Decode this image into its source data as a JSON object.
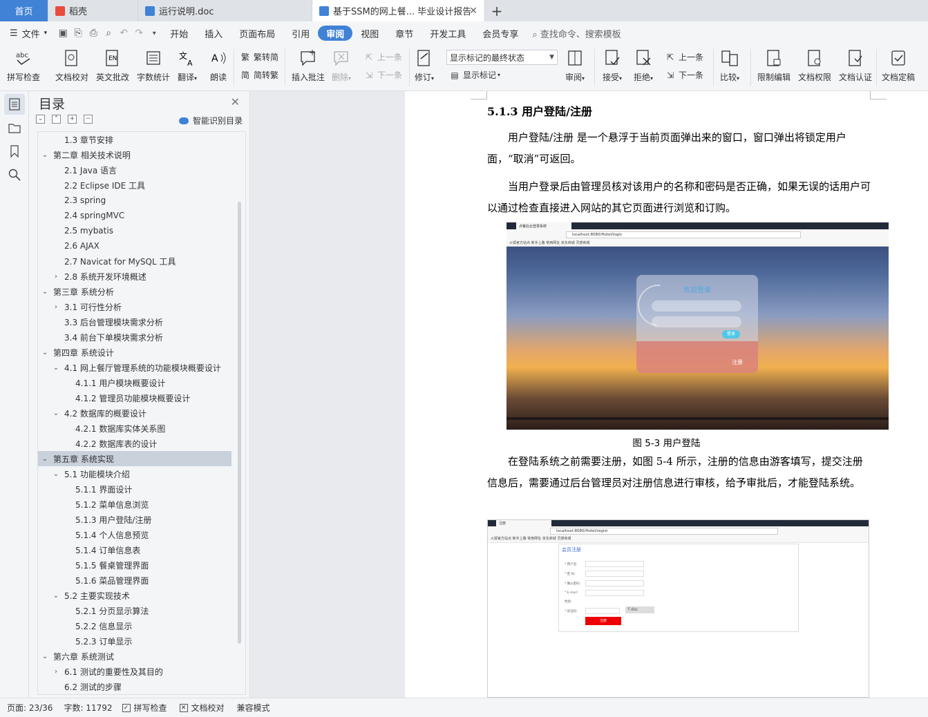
{
  "tabs": {
    "home": "首页",
    "daoke": "稻壳",
    "doc1": "运行说明.doc",
    "doc2": "基于SSM的网上餐... 毕业设计报告",
    "new_tab": "+",
    "close": "✕"
  },
  "menu": {
    "file": "文件",
    "items": [
      "开始",
      "插入",
      "页面布局",
      "引用",
      "审阅",
      "视图",
      "章节",
      "开发工具",
      "会员专享"
    ],
    "active": "审阅",
    "search": "查找命令、搜索模板"
  },
  "ribbon": {
    "spell_check": "拼写检查",
    "doc_proof": "文档校对",
    "english_review": "英文批改",
    "word_count": "字数统计",
    "translate": "翻译",
    "read_aloud": "朗读",
    "to_traditional": "繁转简",
    "to_simplified": "简转繁",
    "insert_comment": "插入批注",
    "delete": "删除",
    "prev_comment": "上一条",
    "next_comment": "下一条",
    "track_changes": "修订",
    "markup_state": "显示标记的最终状态",
    "show_markup": "显示标记",
    "review": "审阅",
    "accept": "接受",
    "reject": "拒绝",
    "prev_change": "上一条",
    "next_change": "下一条",
    "compare": "比较",
    "restrict_edit": "限制编辑",
    "doc_permission": "文档权限",
    "doc_certify": "文档认证",
    "doc_finalize": "文档定稿"
  },
  "toc": {
    "title": "目录",
    "smart_toc": "智能识别目录",
    "items": [
      {
        "label": "1.3 章节安排",
        "level": 2,
        "arrow": ""
      },
      {
        "label": "第二章  相关技术说明",
        "level": 1,
        "arrow": "down"
      },
      {
        "label": "2.1 Java 语言",
        "level": 2,
        "arrow": ""
      },
      {
        "label": "2.2 Eclipse IDE 工具",
        "level": 2,
        "arrow": ""
      },
      {
        "label": "2.3 spring",
        "level": 2,
        "arrow": ""
      },
      {
        "label": "2.4 springMVC",
        "level": 2,
        "arrow": ""
      },
      {
        "label": "2.5 mybatis",
        "level": 2,
        "arrow": ""
      },
      {
        "label": "2.6 AJAX",
        "level": 2,
        "arrow": ""
      },
      {
        "label": "2.7 Navicat for MySQL 工具",
        "level": 2,
        "arrow": ""
      },
      {
        "label": "2.8 系统开发环境概述",
        "level": 2,
        "arrow": "right"
      },
      {
        "label": "第三章  系统分析",
        "level": 1,
        "arrow": "down"
      },
      {
        "label": "3.1 可行性分析",
        "level": 2,
        "arrow": "right"
      },
      {
        "label": "3.3 后台管理模块需求分析",
        "level": 2,
        "arrow": ""
      },
      {
        "label": "3.4 前台下单模块需求分析",
        "level": 2,
        "arrow": ""
      },
      {
        "label": "第四章  系统设计",
        "level": 1,
        "arrow": "down"
      },
      {
        "label": "4.1 网上餐厅管理系统的功能模块概要设计",
        "level": 2,
        "arrow": "down"
      },
      {
        "label": "4.1.1 用户模块概要设计",
        "level": 3,
        "arrow": ""
      },
      {
        "label": "4.1.2 管理员功能模块概要设计",
        "level": 3,
        "arrow": ""
      },
      {
        "label": "4.2 数据库的概要设计",
        "level": 2,
        "arrow": "down"
      },
      {
        "label": "4.2.1 数据库实体关系图",
        "level": 3,
        "arrow": ""
      },
      {
        "label": "4.2.2 数据库表的设计",
        "level": 3,
        "arrow": ""
      },
      {
        "label": "第五章  系统实现",
        "level": 1,
        "arrow": "down",
        "selected": true
      },
      {
        "label": "5.1 功能模块介绍",
        "level": 2,
        "arrow": "down"
      },
      {
        "label": "5.1.1 界面设计",
        "level": 3,
        "arrow": ""
      },
      {
        "label": "5.1.2  菜单信息浏览",
        "level": 3,
        "arrow": ""
      },
      {
        "label": "5.1.3  用户登陆/注册",
        "level": 3,
        "arrow": ""
      },
      {
        "label": "5.1.4  个人信息预览",
        "level": 3,
        "arrow": ""
      },
      {
        "label": "5.1.4  订单信息表",
        "level": 3,
        "arrow": ""
      },
      {
        "label": "5.1.5  餐桌管理界面",
        "level": 3,
        "arrow": ""
      },
      {
        "label": "5.1.6  菜品管理界面",
        "level": 3,
        "arrow": ""
      },
      {
        "label": "5.2 主要实现技术",
        "level": 2,
        "arrow": "down"
      },
      {
        "label": "5.2.1 分页显示算法",
        "level": 3,
        "arrow": ""
      },
      {
        "label": "5.2.2  信息显示",
        "level": 3,
        "arrow": ""
      },
      {
        "label": "5.2.3  订单显示",
        "level": 3,
        "arrow": ""
      },
      {
        "label": "第六章  系统测试",
        "level": 1,
        "arrow": "down"
      },
      {
        "label": "6.1 测试的重要性及其目的",
        "level": 2,
        "arrow": "right"
      },
      {
        "label": "6.2 测试的步骤",
        "level": 2,
        "arrow": ""
      }
    ]
  },
  "document": {
    "heading": "5.1.3  用户登陆/注册",
    "para1": "用户登陆/注册 是一个悬浮于当前页面弹出来的窗口，窗口弹出将锁定用户面，“取消”可返回。",
    "para2": "当用户登录后由管理员核对该用户的名称和密码是否正确，如果无误的话用户可以通过检查直接进入网站的其它页面进行浏览和订购。",
    "caption": "图 5-3  用户登陆",
    "para3": "在登陆系统之前需要注册，如图 5-4 所示，注册的信息由游客填写，提交注册信息后，需要通过后台管理员对注册信息进行审核，给予审批后，才能登陆系统。",
    "shot1": {
      "tab": "点餐后台登录系统",
      "url": "localhost:8080/Hotel/login",
      "bookmarks": "火狐官方站点  新手上路  常用网址  京东商城  灵感商城",
      "welcome": "欢迎登录",
      "login_btn": "登录",
      "register": "注册"
    },
    "shot2": {
      "tab": "注册",
      "url": "localhost:8080/Hotel/regist",
      "bookmarks": "火狐官方站点  新手上路  常用网址  京东商城  灵感商城",
      "form_title": "会员注册",
      "fields": [
        "* 用户名:",
        "* 密  码:",
        "* 确认密码:",
        "* E-mail:",
        "性别:",
        "* 验证码:"
      ],
      "captcha": "f dsc",
      "submit": "注册"
    }
  },
  "status": {
    "page": "页面: 23/36",
    "words": "字数: 11792",
    "spell": "拼写检查",
    "proof": "文档校对",
    "compat": "兼容模式"
  },
  "colors": {
    "accent": "#3f82d6",
    "selected_toc": "#c9d1db"
  }
}
